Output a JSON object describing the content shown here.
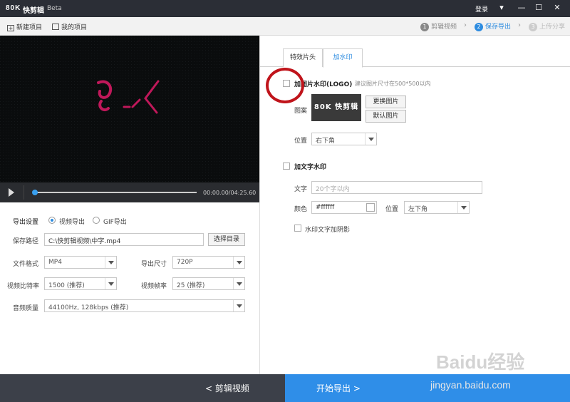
{
  "app": {
    "logo": "80K",
    "name": "快剪辑",
    "badge": "Beta",
    "login": "登录"
  },
  "window_controls": {
    "menu": "▾",
    "minimize": "—",
    "maximize": "☐",
    "close": "✕"
  },
  "toolbar": {
    "new_project": "新建项目",
    "my_projects": "我的项目"
  },
  "steps": [
    {
      "num": "1",
      "label": "剪辑视频"
    },
    {
      "num": "2",
      "label": "保存导出"
    },
    {
      "num": "3",
      "label": "上传分享"
    }
  ],
  "player": {
    "time": "00:00.00/04:25.60",
    "progress": 0.0,
    "colors": {
      "accent": "#39a0f0",
      "background": "#0a0c0d"
    }
  },
  "export": {
    "settings_label": "导出设置",
    "mode_video": "视频导出",
    "mode_gif": "GIF导出",
    "selected_mode": "视频导出",
    "save_path_label": "保存路径",
    "save_path_value": "C:\\快剪辑视频\\中字.mp4",
    "choose_dir": "选择目录",
    "format_label": "文件格式",
    "format_value": "MP4",
    "size_label": "导出尺寸",
    "size_value": "720P",
    "bitrate_label": "视频比特率",
    "bitrate_value": "1500 (推荐)",
    "fps_label": "视频帧率",
    "fps_value": "25 (推荐)",
    "audio_label": "音频质量",
    "audio_value": "44100Hz, 128kbps (推荐)"
  },
  "tabs": [
    {
      "label": "特效片头"
    },
    {
      "label": "加水印"
    }
  ],
  "watermark": {
    "logo_checkbox_label": "加图片水印(LOGO)",
    "logo_hint": "建议图片尺寸在500*500以内",
    "pattern_label": "图案",
    "preview_text": "80K 快剪辑",
    "change_image": "更换图片",
    "default_image": "默认图片",
    "position_label": "位置",
    "position_value": "右下角",
    "text_checkbox_label": "加文字水印",
    "text_label": "文字",
    "text_placeholder": "20个字以内",
    "color_label": "颜色",
    "color_value": "#ffffff",
    "text_position_label": "位置",
    "text_position_value": "左下角",
    "shadow_label": "水印文字加阴影"
  },
  "bottom": {
    "back": "< 剪辑视频",
    "export": "开始导出 >"
  },
  "page_watermark": {
    "brand": "Baidu经验",
    "url": "jingyan.baidu.com"
  },
  "colors": {
    "primary": "#2f8ee8",
    "dark": "#3c4049",
    "titlebar": "#2b2e36",
    "annotation": "#c0141b"
  }
}
